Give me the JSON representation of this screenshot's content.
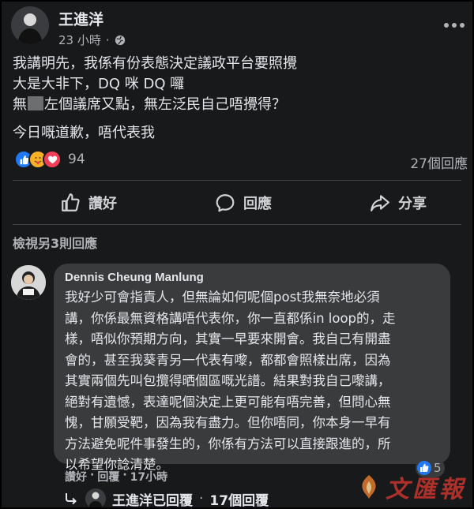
{
  "post": {
    "author": "王進洋",
    "time": "23 小時",
    "lines": [
      "我講明先，我係有份表態決定議政平台要照攪",
      "大是大非下，DQ 咪 DQ 囉",
      "無",
      "左個議席又點，無左泛民自己唔攪得？",
      "今日嘅道歉，唔代表我"
    ],
    "reaction_count": "94",
    "comment_count": "27個回應",
    "reactions": [
      "like-icon",
      "care-icon",
      "love-icon"
    ]
  },
  "actions": {
    "like": "讚好",
    "comment": "回應",
    "share": "分享"
  },
  "comments": {
    "view_more": "檢視另3則回應",
    "commenter": "Dennis Cheung Manlung",
    "lines": [
      "我好少可會指責人，但無論如何呢個post我無奈地必須",
      "講，你係最無資格講唔代表你，你一直都係in loop的，走",
      "樣，唔似你預期方向，其實一早要來開會。我自己有開盡",
      "會的，甚至我葵青另一代表有嚟，都都會照樣出席，因為",
      "其實兩個先叫包攬得晒個區嘅光譜。結果對我自己嚟講，",
      "絕對有遺憾，表達呢個決定上更可能有唔完善，但問心無",
      "愧，甘願受靶，因為我有盡力。但你唔同，你本身一早有",
      "方法避免呢件事發生的，你係有方法可以直接跟進的，所",
      "以希望你諗清楚。"
    ],
    "like_count": "5",
    "like_label": "讚好",
    "sep": "·",
    "reply_label": "回覆",
    "time": "17小時",
    "reply_summary": "王進洋已回覆",
    "reply_count": "17個回覆"
  },
  "watermark": "文匯報",
  "colors": {
    "background": "#18191a",
    "bubble": "#3a3b3c",
    "text": "#e4e6eb",
    "muted": "#b0b3b8",
    "like_blue": "#2078f4",
    "love_red": "#f33e58",
    "care_yellow": "#f7b125",
    "watermark_red": "#c8362d"
  }
}
